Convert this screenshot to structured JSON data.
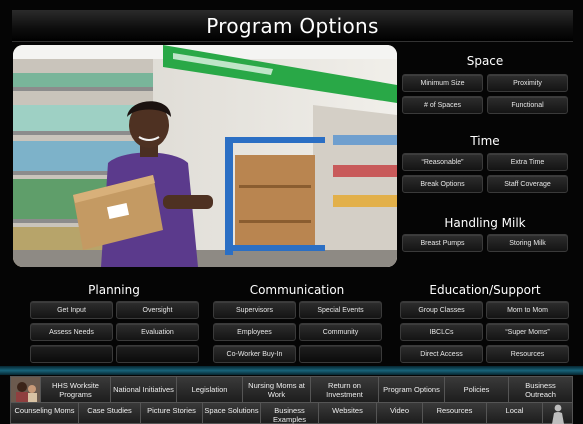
{
  "page": {
    "title": "Program Options"
  },
  "space": {
    "heading": "Space",
    "buttons": [
      "Minimum Size",
      "Proximity",
      "# of Spaces",
      "Functional"
    ]
  },
  "time": {
    "heading": "Time",
    "buttons": [
      "“Reasonable”",
      "Extra Time",
      "Break Options",
      "Staff Coverage"
    ]
  },
  "milk": {
    "heading": "Handling Milk",
    "buttons": [
      "Breast Pumps",
      "Storing Milk"
    ]
  },
  "planning": {
    "heading": "Planning",
    "buttons": [
      "Get Input",
      "Oversight",
      "Assess Needs",
      "Evaluation",
      "",
      ""
    ]
  },
  "communication": {
    "heading": "Communication",
    "buttons": [
      "Supervisors",
      "Special Events",
      "Employees",
      "Community",
      "Co-Worker Buy-In",
      ""
    ]
  },
  "education": {
    "heading": "Education/Support",
    "buttons": [
      "Group Classes",
      "Mom to Mom",
      "IBCLCs",
      "“Super Moms”",
      "Direct Access",
      "Resources"
    ]
  },
  "nav_top": [
    "HHS Worksite Programs",
    "National Initiatives",
    "Legislation",
    "Nursing Moms at Work",
    "Return on Investment",
    "Program Options",
    "Policies",
    "Business Outreach"
  ],
  "nav_bottom": [
    "Counseling Moms",
    "Case Studies",
    "Picture Stories",
    "Space Solutions",
    "Business Examples",
    "Websites",
    "Video",
    "Resources",
    "Local"
  ],
  "colors": {
    "background": "#050505",
    "teal_band": "#18647a",
    "store_wall": "#e9e7e2",
    "uniform_purple": "#5b3a8c",
    "cart_blue": "#2b6fc4"
  },
  "icons": {
    "person": "person-icon"
  }
}
